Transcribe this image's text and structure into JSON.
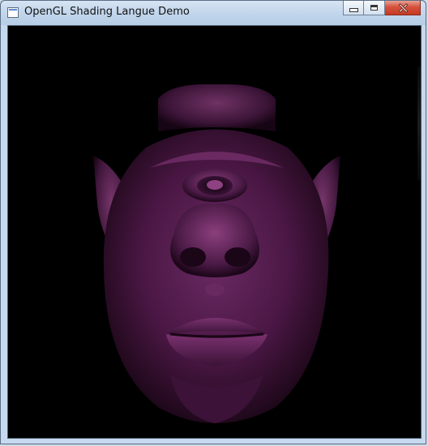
{
  "window": {
    "title": "OpenGL Shading Langue Demo",
    "icon": "app-window-icon",
    "controls": [
      "minimize-icon",
      "maximize-icon",
      "close-icon"
    ]
  },
  "render": {
    "background_color": "#000000",
    "shading_color": "#5e1e55",
    "highlight_color": "#8a3a7c"
  }
}
